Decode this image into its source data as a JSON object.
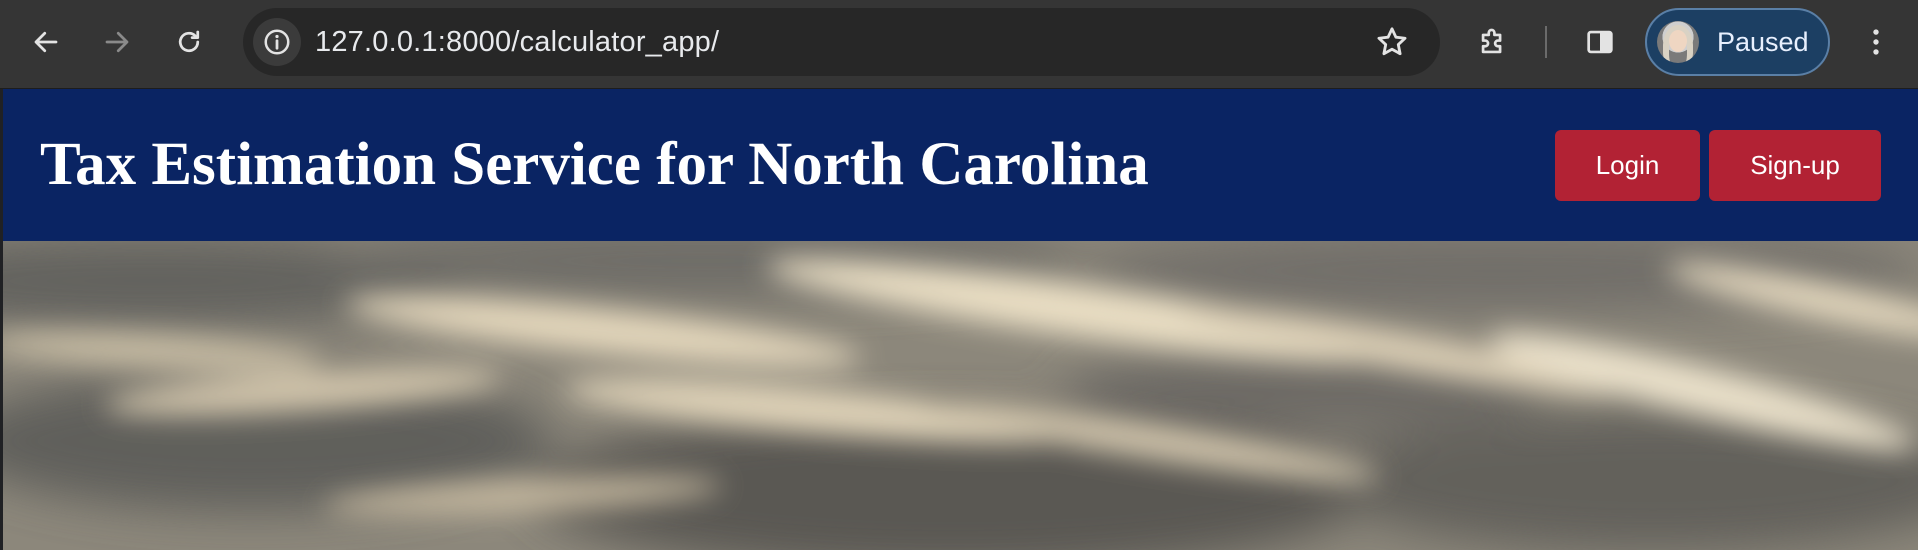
{
  "browser": {
    "url": "127.0.0.1:8000/calculator_app/",
    "profile_label": "Paused",
    "icons": {
      "back": "arrow-left-icon",
      "forward": "arrow-right-icon",
      "reload": "reload-icon",
      "site_info": "info-icon",
      "bookmark": "star-icon",
      "extensions": "puzzle-icon",
      "side_panel": "side-panel-icon",
      "menu": "more-vertical-icon"
    }
  },
  "header": {
    "title": "Tax Estimation Service for North Carolina",
    "login_label": "Login",
    "signup_label": "Sign-up"
  },
  "colors": {
    "header_bg": "#0a2463",
    "button_bg": "#b22234",
    "chrome_bg": "#353535",
    "omnibox_bg": "#272727",
    "profile_chip_bg": "#1c3f63"
  }
}
